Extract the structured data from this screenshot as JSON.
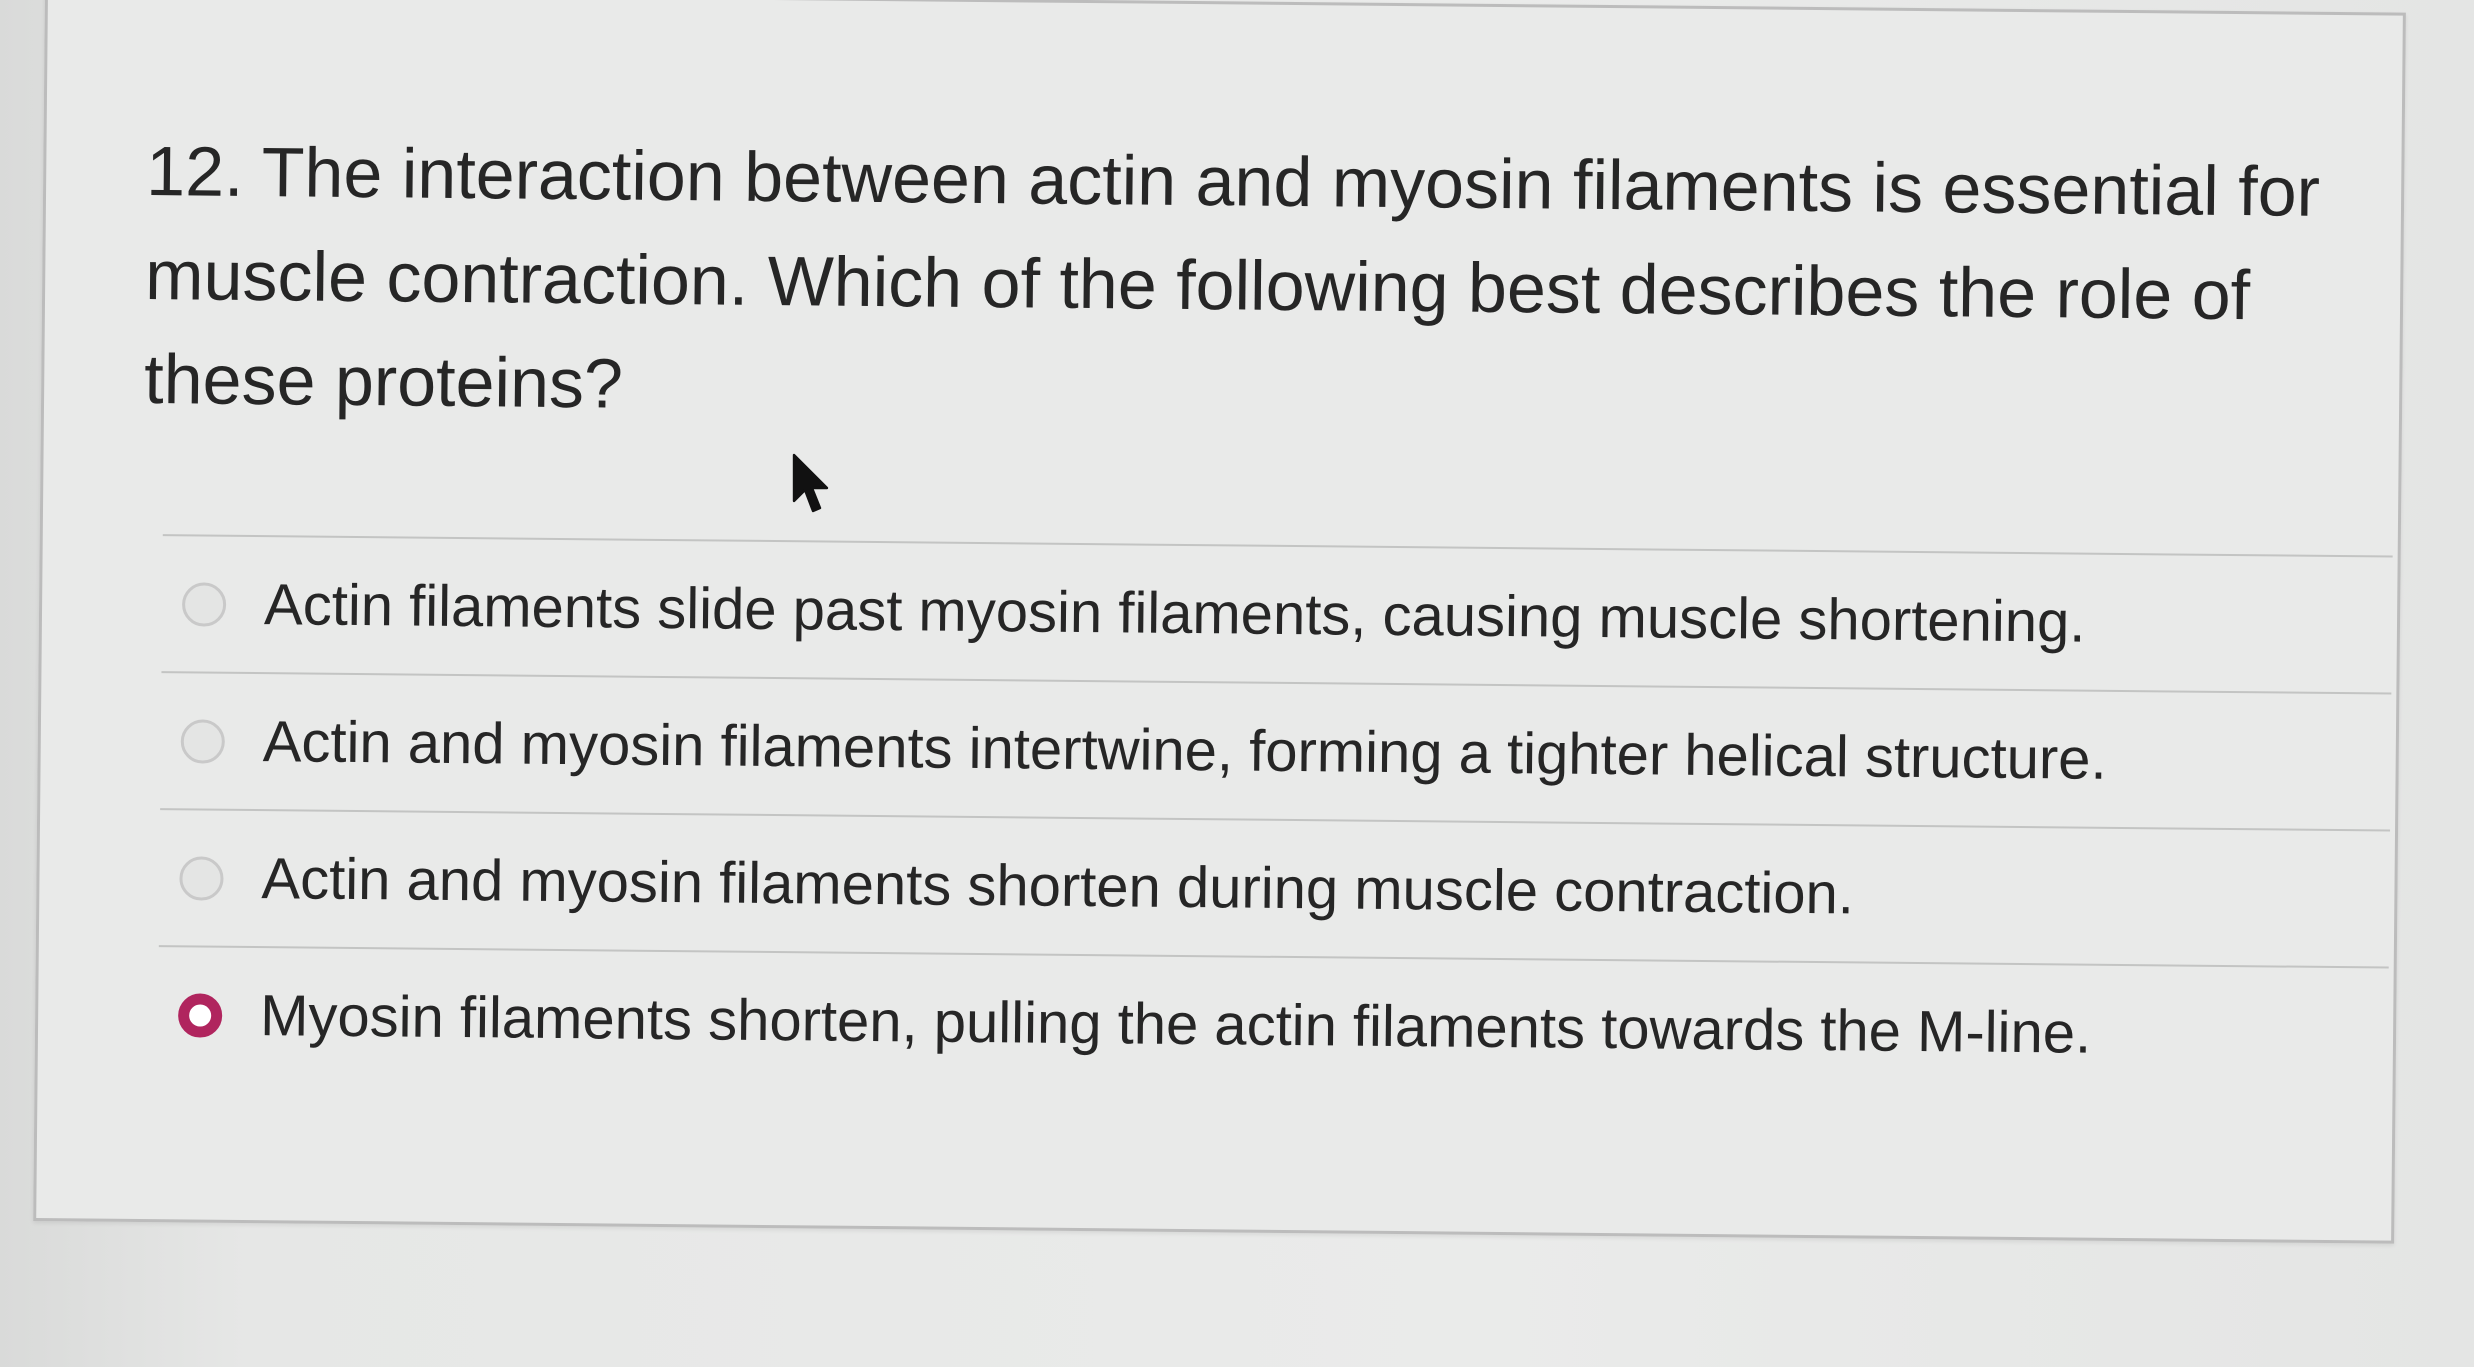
{
  "question": {
    "text": "12. The interaction between actin and myosin filaments is essential for muscle contraction. Which of the following best describes the role of these proteins?"
  },
  "options": [
    {
      "label": "Actin filaments slide past myosin filaments, causing muscle shortening.",
      "selected": false
    },
    {
      "label": "Actin and myosin filaments intertwine, forming a tighter helical structure.",
      "selected": false
    },
    {
      "label": "Actin and myosin filaments shorten during muscle contraction.",
      "selected": false
    },
    {
      "label": "Myosin filaments shorten, pulling the actin filaments towards the M-line.",
      "selected": true
    }
  ],
  "colors": {
    "selected_radio": "#b0255e",
    "card_background": "#e9eae9",
    "text": "#262626"
  },
  "icons": {
    "pointer": "mouse-pointer-icon"
  }
}
